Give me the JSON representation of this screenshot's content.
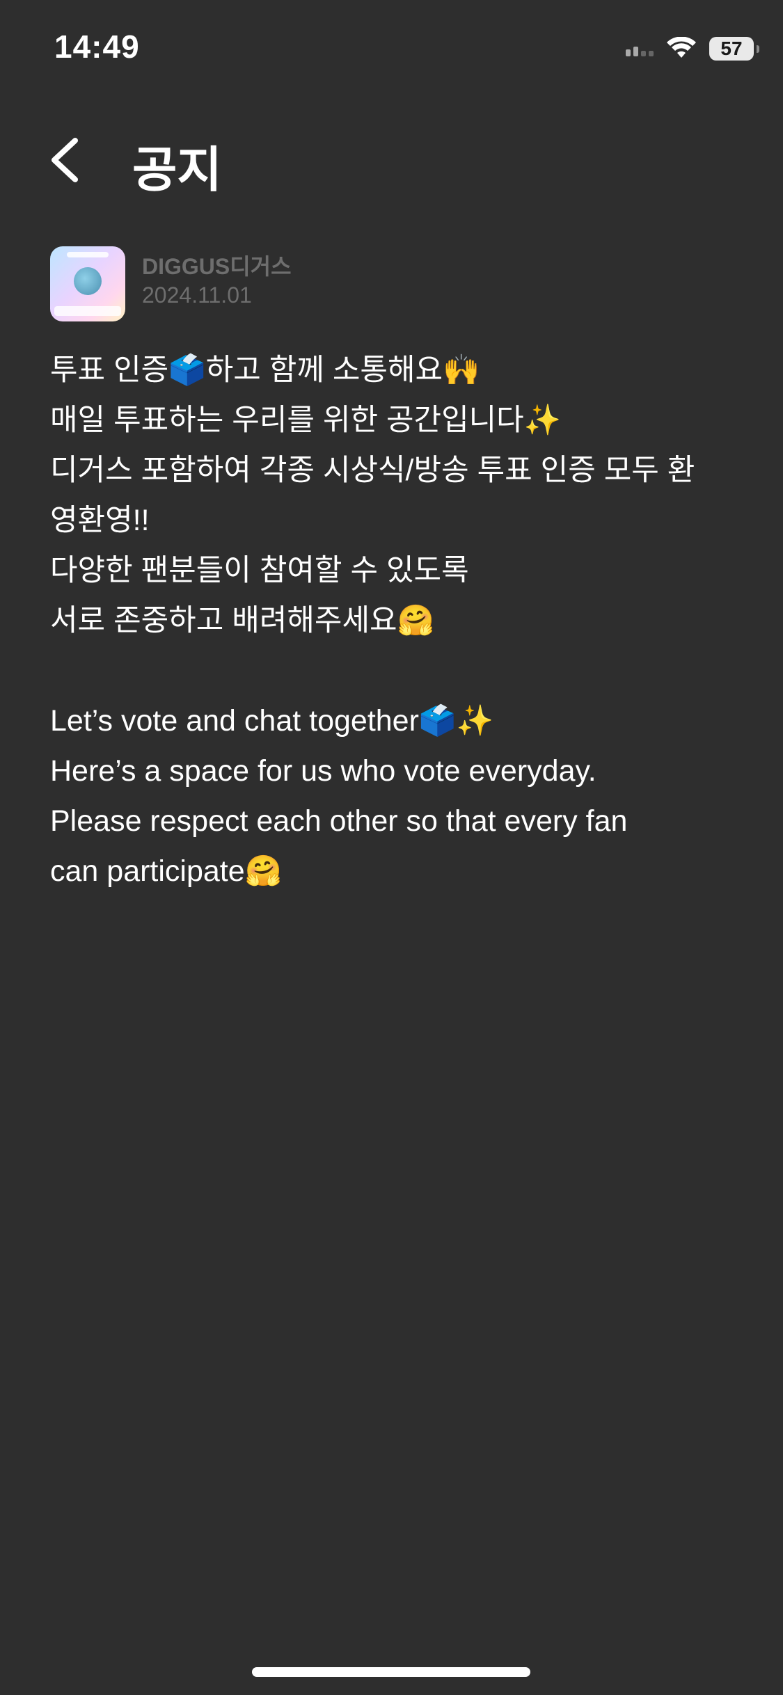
{
  "status_bar": {
    "time": "14:49",
    "battery_level": "57",
    "icons": [
      "cellular-signal-icon",
      "wifi-icon",
      "battery-icon"
    ]
  },
  "header": {
    "title": "공지",
    "back_icon": "chevron-left-icon"
  },
  "post": {
    "author": "DIGGUS디거스",
    "date": "2024.11.01",
    "avatar_icon": "app-logo-avatar",
    "lines": [
      "투표 인증🗳️하고 함께 소통해요🙌",
      "매일 투표하는 우리를 위한 공간입니다✨",
      "디거스 포함하여 각종 시상식/방송 투표 인증 모두 환",
      "영환영!!",
      "다양한 팬분들이 참여할 수 있도록",
      "서로 존중하고 배려해주세요🤗",
      "",
      "Let’s vote and chat together🗳️✨",
      "Here’s a space for us who vote everyday.",
      "Please respect each other so that every fan",
      "can participate🤗"
    ]
  },
  "colors": {
    "background": "#2e2e2e",
    "text_primary": "#ffffff",
    "text_secondary": "#6e6e6e"
  }
}
